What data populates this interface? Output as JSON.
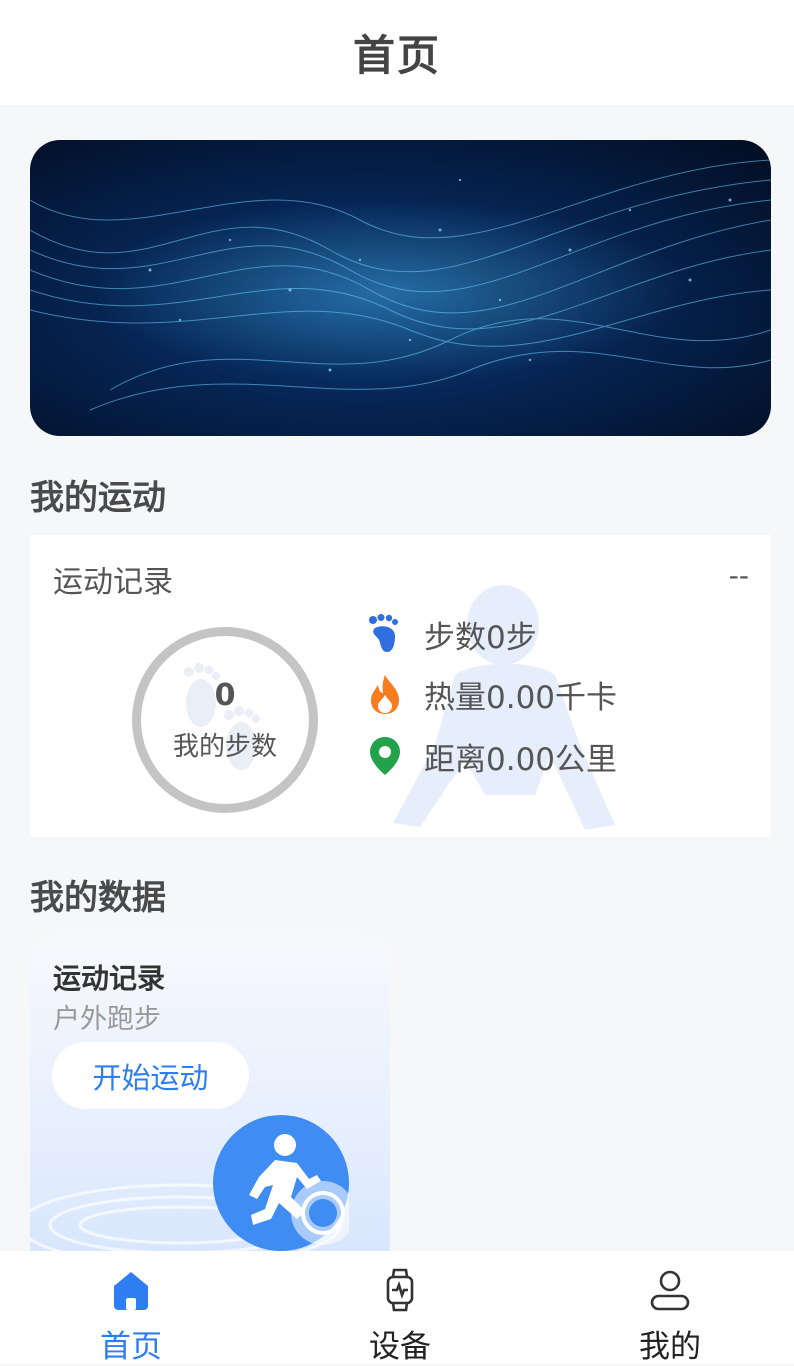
{
  "header": {
    "title": "首页"
  },
  "sections": {
    "my_sport": "我的运动",
    "my_data": "我的数据"
  },
  "sport_card": {
    "title": "运动记录",
    "date": "--",
    "steps_ring": {
      "value": "0",
      "label": "我的步数"
    },
    "stats": [
      {
        "icon": "footprint-icon",
        "text": "步数0步"
      },
      {
        "icon": "fire-icon",
        "text": "热量0.00千卡"
      },
      {
        "icon": "location-pin-icon",
        "text": "距离0.00公里"
      }
    ]
  },
  "data_card": {
    "title": "运动记录",
    "subtitle": "户外跑步",
    "button": "开始运动"
  },
  "tabbar": {
    "active": "首页",
    "tabs": [
      {
        "label": "首页",
        "icon": "home-icon"
      },
      {
        "label": "设备",
        "icon": "watch-icon"
      },
      {
        "label": "我的",
        "icon": "user-icon"
      }
    ]
  },
  "colors": {
    "accent": "#2f7df2",
    "fire": "#f57c1f",
    "pin": "#22a34a",
    "ring": "#c4c4c4"
  }
}
